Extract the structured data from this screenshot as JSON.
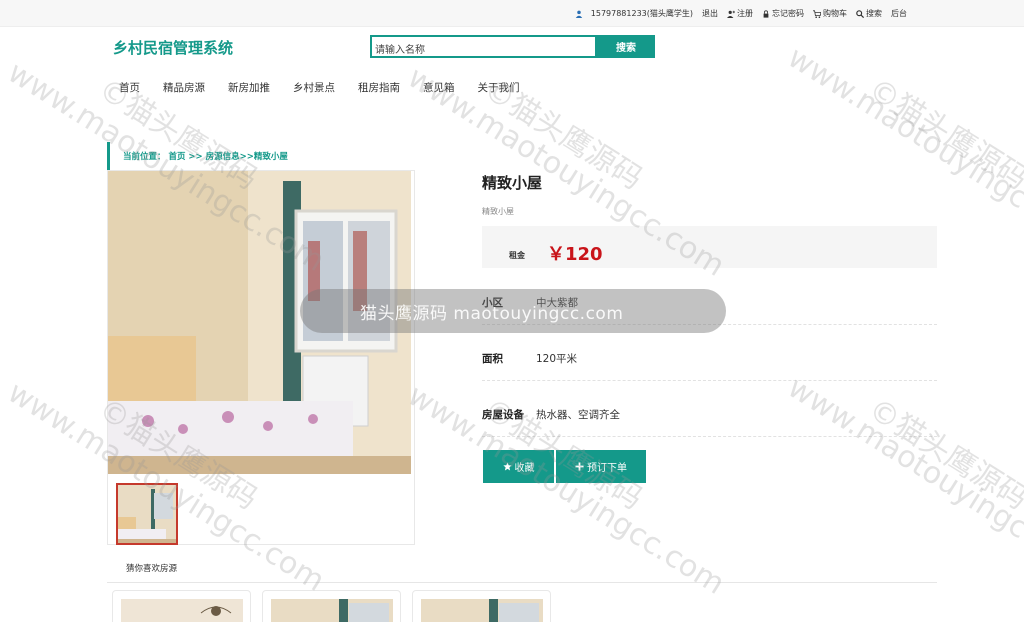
{
  "topbar": {
    "user": "15797881233(猫头鹰学生)",
    "logout": "退出",
    "register": "注册",
    "forgot_password": "忘记密码",
    "cart": "购物车",
    "search": "搜索",
    "backend": "后台"
  },
  "header": {
    "logo": "乡村民宿管理系统",
    "search_value": "请输入名称",
    "search_button": "搜索"
  },
  "nav": [
    "首页",
    "精品房源",
    "新房加推",
    "乡村景点",
    "租房指南",
    "意见箱",
    "关于我们"
  ],
  "breadcrumb": "当前位置： 首页 >> 房源信息>>精致小屋",
  "listing": {
    "title": "精致小屋",
    "subtitle": "精致小屋",
    "price_label": "租金",
    "price_value": "￥120",
    "rows": [
      {
        "key": "小区",
        "value": "中大紫都"
      },
      {
        "key": "面积",
        "value": "120平米"
      },
      {
        "key": "房屋设备",
        "value": "热水器、空调齐全"
      }
    ],
    "favorite_button": "收藏",
    "book_button": "预订下单"
  },
  "recommend": {
    "title": "猜你喜欢房源"
  },
  "watermark": {
    "band": "猫头鹰源码 maotouyingcc.com",
    "text": "www.maotouyingcc.com",
    "mark": "©猫头鹰源码"
  }
}
